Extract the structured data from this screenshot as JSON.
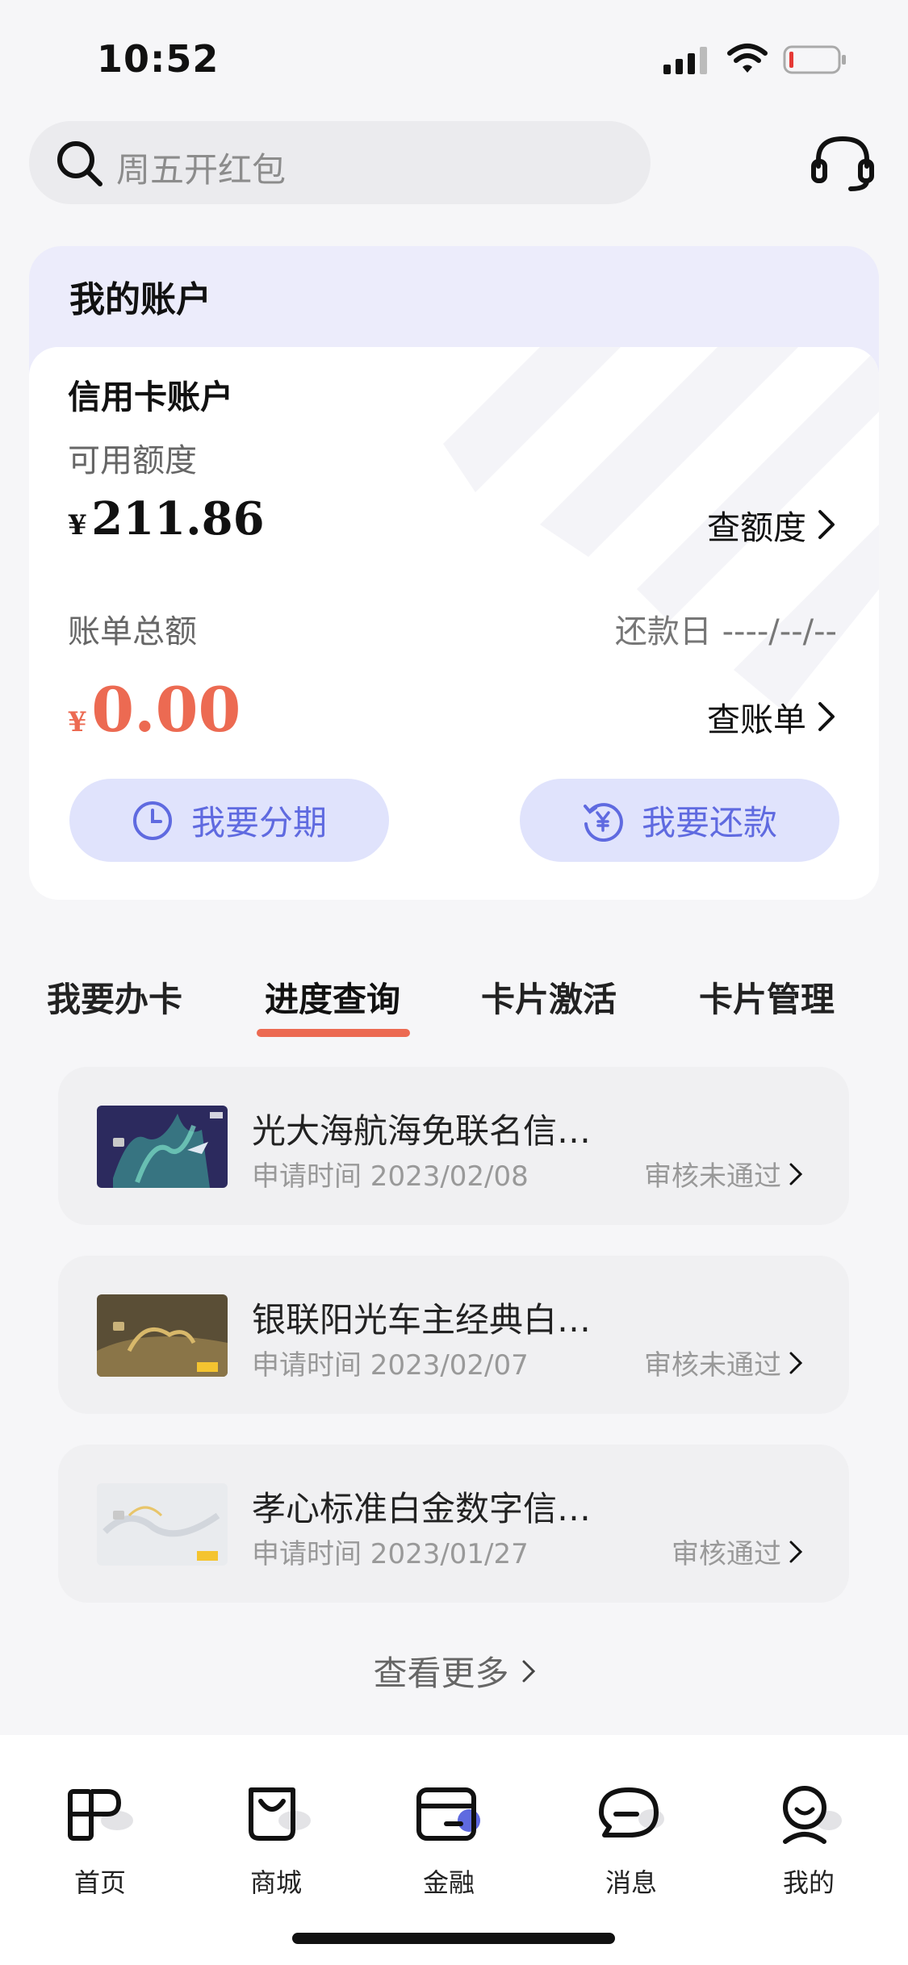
{
  "status_bar": {
    "time": "10:52"
  },
  "search": {
    "placeholder": "周五开红包"
  },
  "account": {
    "title": "我的账户",
    "credit_title": "信用卡账户",
    "available_label": "可用额度",
    "available_currency": "¥",
    "available_amount": "211.86",
    "check_limit": "查额度",
    "bill_total_label": "账单总额",
    "due_date_label": "还款日 ----/--/--",
    "bill_currency": "¥",
    "bill_amount": "0.00",
    "check_bill": "查账单",
    "installment_button": "我要分期",
    "repay_button": "我要还款"
  },
  "tabs": [
    {
      "label": "我要办卡"
    },
    {
      "label": "进度查询",
      "active": true
    },
    {
      "label": "卡片激活"
    },
    {
      "label": "卡片管理"
    }
  ],
  "applications": [
    {
      "title": "光大海航海免联名信…",
      "date": "申请时间 2023/02/08",
      "status": "审核未通过"
    },
    {
      "title": "银联阳光车主经典白…",
      "date": "申请时间 2023/02/07",
      "status": "审核未通过"
    },
    {
      "title": "孝心标准白金数字信…",
      "date": "申请时间 2023/01/27",
      "status": "审核通过"
    }
  ],
  "view_more": "查看更多",
  "bottom_nav": [
    {
      "label": "首页",
      "icon": "home-icon"
    },
    {
      "label": "商城",
      "icon": "shop-icon"
    },
    {
      "label": "金融",
      "icon": "finance-icon",
      "active": true
    },
    {
      "label": "消息",
      "icon": "message-icon"
    },
    {
      "label": "我的",
      "icon": "profile-icon"
    }
  ],
  "colors": {
    "accent_orange": "#ec6a52",
    "accent_purple": "#5f6ae0",
    "panel_bg": "#ececfb"
  }
}
